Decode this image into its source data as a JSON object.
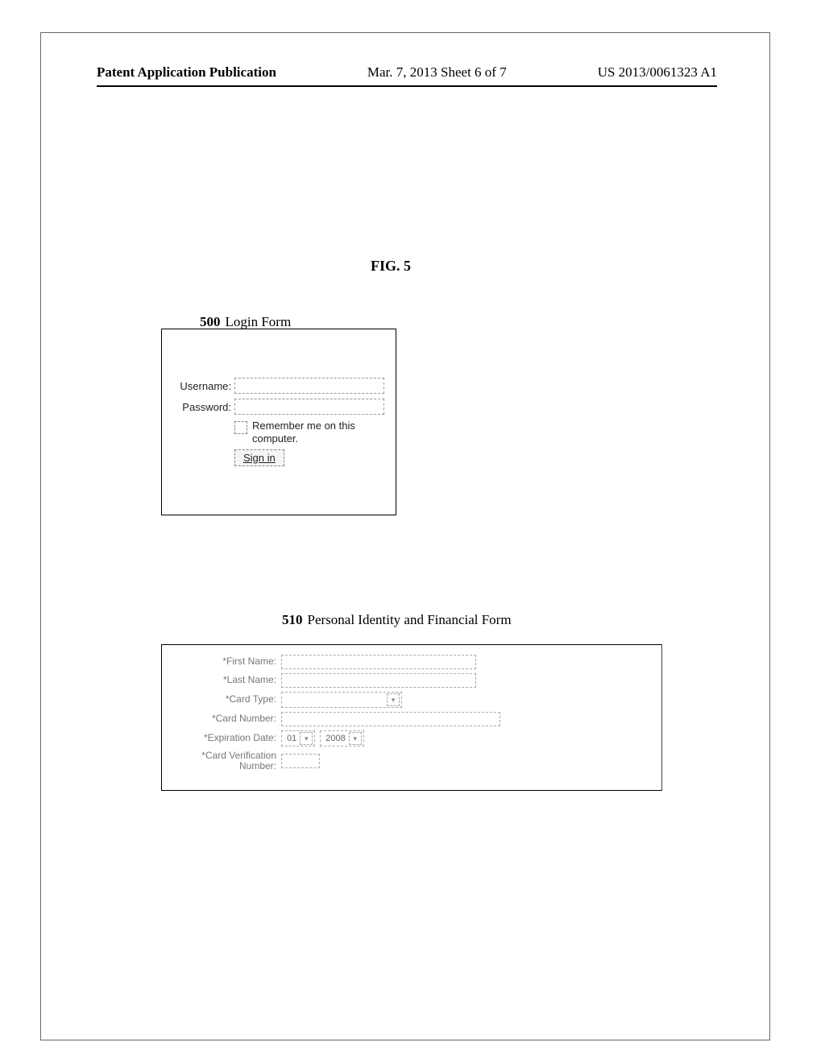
{
  "header": {
    "publication_label": "Patent Application Publication",
    "date": "Mar. 7, 2013  Sheet 6 of 7",
    "pub_number": "US 2013/0061323 A1"
  },
  "figure_label": "FIG. 5",
  "login": {
    "ref_number": "500",
    "ref_title": "Login Form",
    "username_label": "Username:",
    "password_label": "Password:",
    "remember_label": "Remember me on this computer.",
    "signin_label": "Sign in"
  },
  "financial": {
    "ref_number": "510",
    "ref_title": "Personal Identity and Financial Form",
    "first_name_label": "*First Name:",
    "last_name_label": "*Last Name:",
    "card_type_label": "*Card Type:",
    "card_number_label": "*Card Number:",
    "expiration_label": "*Expiration Date:",
    "exp_month_value": "01",
    "exp_year_value": "2008",
    "cvn_label": "*Card Verification Number:",
    "dropdown_glyph": "▾"
  }
}
